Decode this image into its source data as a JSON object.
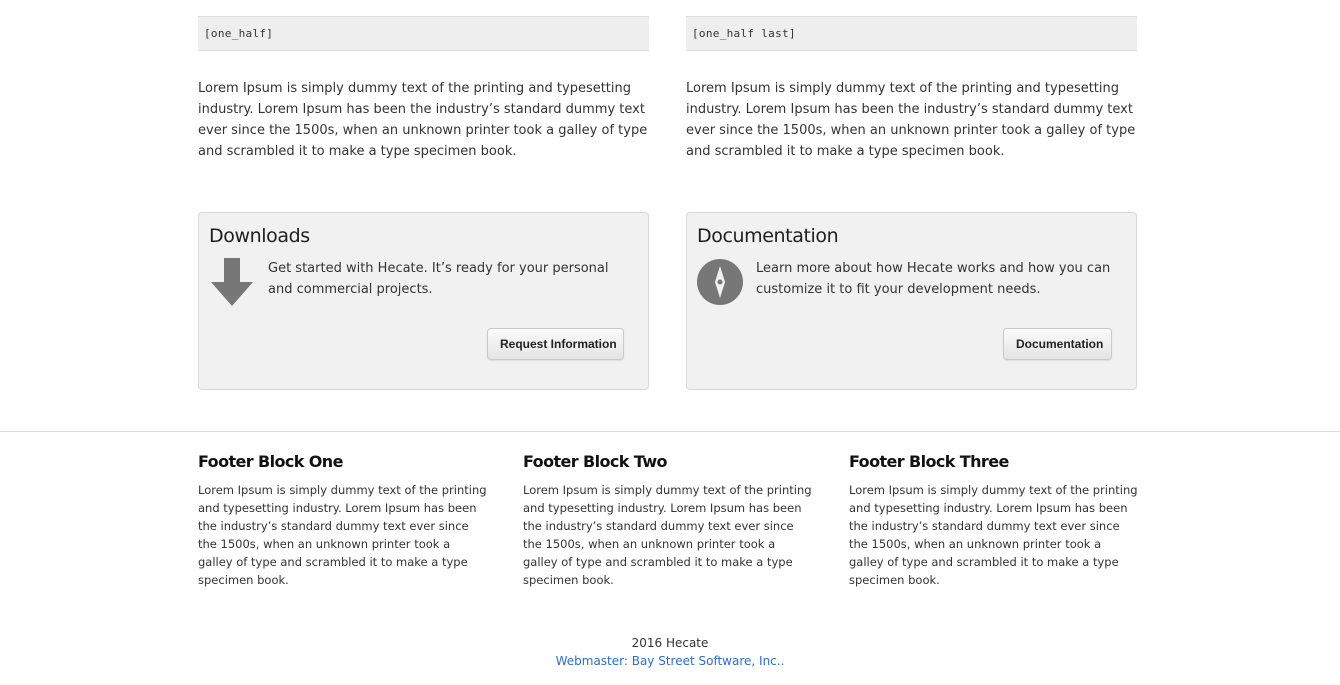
{
  "columns": {
    "left": {
      "code": "[one_half]",
      "text": "Lorem Ipsum is simply dummy text of the printing and typesetting industry. Lorem Ipsum has been the industry’s standard dummy text ever since the 1500s, when an unknown printer took a galley of type and scrambled it to make a type specimen book."
    },
    "right": {
      "code": "[one_half last]",
      "text": "Lorem Ipsum is simply dummy text of the printing and typesetting industry. Lorem Ipsum has been the industry’s standard dummy text ever since the 1500s, when an unknown printer took a galley of type and scrambled it to make a type specimen book."
    }
  },
  "panels": {
    "downloads": {
      "title": "Downloads",
      "icon": "download-arrow-icon",
      "text": "Get started with Hecate. It’s ready for your personal and commercial projects.",
      "button_label": "Request Information"
    },
    "documentation": {
      "title": "Documentation",
      "icon": "compass-icon",
      "text": "Learn more about how Hecate works and how you can customize it to fit your development needs.",
      "button_label": "Documentation"
    }
  },
  "footer": {
    "blocks": [
      {
        "title": "Footer Block One",
        "text": "Lorem Ipsum is simply dummy text of the printing and typesetting industry. Lorem Ipsum has been the industry’s standard dummy text ever since the 1500s, when an unknown printer took a galley of type and scrambled it to make a type specimen book."
      },
      {
        "title": "Footer Block Two",
        "text": "Lorem Ipsum is simply dummy text of the printing and typesetting industry. Lorem Ipsum has been the industry’s standard dummy text ever since the 1500s, when an unknown printer took a galley of type and scrambled it to make a type specimen book."
      },
      {
        "title": "Footer Block Three",
        "text": "Lorem Ipsum is simply dummy text of the printing and typesetting industry. Lorem Ipsum has been the industry’s standard dummy text ever since the 1500s, when an unknown printer took a galley of type and scrambled it to make a type specimen book."
      }
    ],
    "copyright": "2016 Hecate",
    "webmaster_link": "Webmaster: Bay Street Software, Inc.."
  },
  "colors": {
    "link": "#2a6fcf",
    "panel_bg": "#f1f1f1",
    "code_bg": "#eeeeee",
    "icon_gray": "#777777"
  }
}
